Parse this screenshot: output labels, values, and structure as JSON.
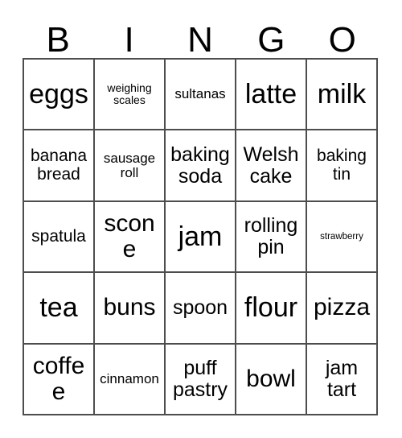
{
  "card": {
    "title_letters": [
      "B",
      "I",
      "N",
      "G",
      "O"
    ],
    "columns": 5,
    "rows": 5,
    "border_color": "#4d4d4d",
    "background_color": "#ffffff",
    "text_color": "#000000",
    "cells": [
      [
        {
          "label": "eggs",
          "size": "fs-xl"
        },
        {
          "label": "weighing\nscales",
          "size": "fs-xxs"
        },
        {
          "label": "sultanas",
          "size": "fs-xs"
        },
        {
          "label": "latte",
          "size": "fs-xl"
        },
        {
          "label": "milk",
          "size": "fs-xl"
        }
      ],
      [
        {
          "label": "banana\nbread",
          "size": "fs-sm"
        },
        {
          "label": "sausage\nroll",
          "size": "fs-xs"
        },
        {
          "label": "baking\nsoda",
          "size": "fs-md"
        },
        {
          "label": "Welsh\ncake",
          "size": "fs-md"
        },
        {
          "label": "baking\ntin",
          "size": "fs-sm"
        }
      ],
      [
        {
          "label": "spatula",
          "size": "fs-sm"
        },
        {
          "label": "scone",
          "size": "fs-lg"
        },
        {
          "label": "jam",
          "size": "fs-xl"
        },
        {
          "label": "rolling\npin",
          "size": "fs-md"
        },
        {
          "label": "strawberry",
          "size": "fs-tiny"
        }
      ],
      [
        {
          "label": "tea",
          "size": "fs-xl"
        },
        {
          "label": "buns",
          "size": "fs-lg"
        },
        {
          "label": "spoon",
          "size": "fs-md"
        },
        {
          "label": "flour",
          "size": "fs-xl"
        },
        {
          "label": "pizza",
          "size": "fs-lg"
        }
      ],
      [
        {
          "label": "coffee",
          "size": "fs-lg"
        },
        {
          "label": "cinnamon",
          "size": "fs-xs"
        },
        {
          "label": "puff\npastry",
          "size": "fs-md"
        },
        {
          "label": "bowl",
          "size": "fs-lg"
        },
        {
          "label": "jam\ntart",
          "size": "fs-md"
        }
      ]
    ]
  }
}
